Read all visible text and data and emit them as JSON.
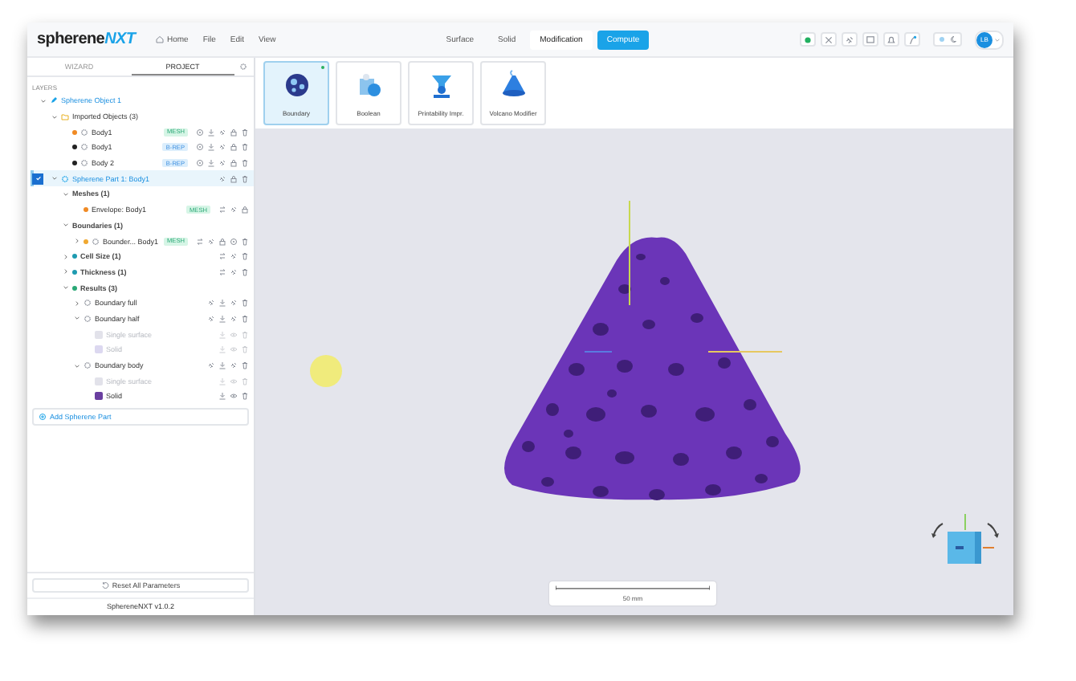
{
  "header": {
    "logo_main": "spherene",
    "logo_accent": "NXT",
    "menu": [
      {
        "label": "Home",
        "kind": "home"
      },
      {
        "label": "File",
        "kind": "plain"
      },
      {
        "label": "Edit",
        "kind": "plain"
      },
      {
        "label": "View",
        "kind": "plain"
      }
    ],
    "modes": [
      {
        "label": "Surface",
        "selected": false
      },
      {
        "label": "Solid",
        "selected": false
      },
      {
        "label": "Modification",
        "selected": true
      }
    ],
    "action_button": "Compute",
    "dark_mode": false,
    "avatar": "LB"
  },
  "panel": {
    "tabs": [
      {
        "label": "WIZARD",
        "selected": false
      },
      {
        "label": "PROJECT",
        "selected": true
      }
    ],
    "section": "LAYERS",
    "tree": [
      {
        "label": "Spherene Object 1",
        "kind": "object",
        "expanded": true,
        "selected": false,
        "children": [
          {
            "label": "Imported Objects (3)",
            "kind": "folder",
            "expanded": true,
            "selected": false,
            "children": [
              {
                "label": "Body1",
                "kind": "body",
                "color": "#f08a24",
                "badge": "MESH",
                "selected": false
              },
              {
                "label": "Body1",
                "kind": "body",
                "color": "#222222",
                "badge": "B-REP",
                "selected": false
              },
              {
                "label": "Body 2",
                "kind": "body",
                "color": "#222222",
                "badge": "B-REP",
                "selected": false
              }
            ]
          },
          {
            "label": "Spherene Part 1: Body1",
            "kind": "part",
            "expanded": true,
            "selected": true,
            "checked": true,
            "children": [
              {
                "label": "Meshes (1)",
                "kind": "group",
                "expanded": true,
                "selected": false,
                "children": [
                  {
                    "label": "Envelope: Body1",
                    "kind": "envelope",
                    "color": "#f08a24",
                    "badge": "MESH",
                    "selected": false
                  }
                ]
              },
              {
                "label": "Boundaries (1)",
                "kind": "group",
                "expanded": true,
                "selected": false,
                "children": [
                  {
                    "label": "Bounder...   Body1",
                    "kind": "boundary",
                    "expanded": false,
                    "color": "#f0a830",
                    "badge": "MESH",
                    "selected": false
                  }
                ]
              },
              {
                "label": "Cell Size (1)",
                "kind": "param",
                "expanded": false,
                "color": "#1e9bb0",
                "selected": false
              },
              {
                "label": "Thickness (1)",
                "kind": "param",
                "expanded": false,
                "color": "#1e9bb0",
                "selected": false
              },
              {
                "label": "Results (3)",
                "kind": "group-result",
                "expanded": true,
                "color": "#2aa876",
                "selected": false,
                "children": [
                  {
                    "label": "Boundary full",
                    "kind": "result",
                    "expanded": false,
                    "selected": false
                  },
                  {
                    "label": "Boundary half",
                    "kind": "result",
                    "expanded": true,
                    "selected": false,
                    "children": [
                      {
                        "label": "Single surface",
                        "kind": "surface",
                        "color": "#e2e2ea",
                        "disabled": true,
                        "selected": false
                      },
                      {
                        "label": "Solid",
                        "kind": "surface",
                        "color": "#dcd8f0",
                        "disabled": true,
                        "selected": false
                      }
                    ]
                  },
                  {
                    "label": "Boundary body",
                    "kind": "result",
                    "expanded": true,
                    "selected": false,
                    "children": [
                      {
                        "label": "Single surface",
                        "kind": "surface",
                        "color": "#e2e2ea",
                        "disabled": true,
                        "selected": false
                      },
                      {
                        "label": "Solid",
                        "kind": "surface",
                        "color": "#6a3fa0",
                        "disabled": false,
                        "selected": false
                      }
                    ]
                  }
                ]
              }
            ]
          }
        ]
      }
    ],
    "add_link": "Add Spherene Part",
    "reset_button": "Reset All Parameters",
    "version": "SphereneNXT v1.0.2"
  },
  "tools": [
    {
      "label": "Boundary",
      "selected": true
    },
    {
      "label": "Boolean",
      "selected": false
    },
    {
      "label": "Printability Impr.",
      "selected": false
    },
    {
      "label": "Volcano Modifier",
      "selected": false
    }
  ],
  "viewport": {
    "scale_label": "50 mm"
  }
}
